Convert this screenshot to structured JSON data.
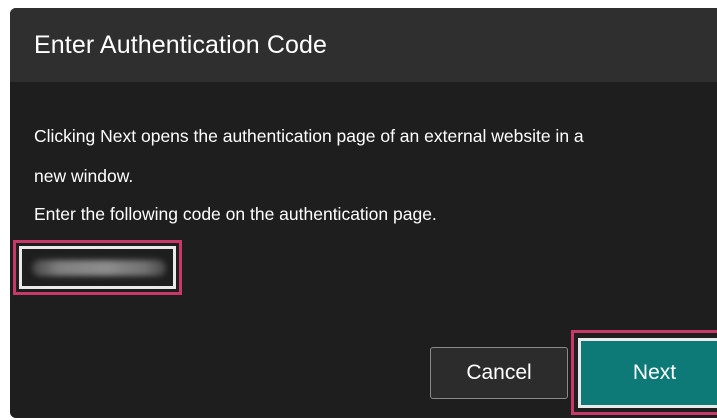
{
  "dialog": {
    "title": "Enter Authentication Code",
    "body": {
      "line1": "Clicking Next opens the authentication page of an external website in a",
      "line2": "new window.",
      "line3": "Enter the following code on the authentication page."
    },
    "code": {
      "value": "",
      "obscured": true
    },
    "buttons": {
      "cancel_label": "Cancel",
      "next_label": "Next"
    }
  },
  "colors": {
    "dialog_background": "#1e1e1e",
    "header_background": "#2f2f2f",
    "primary_button": "#0e7a77",
    "highlight_border": "#c8396a"
  }
}
